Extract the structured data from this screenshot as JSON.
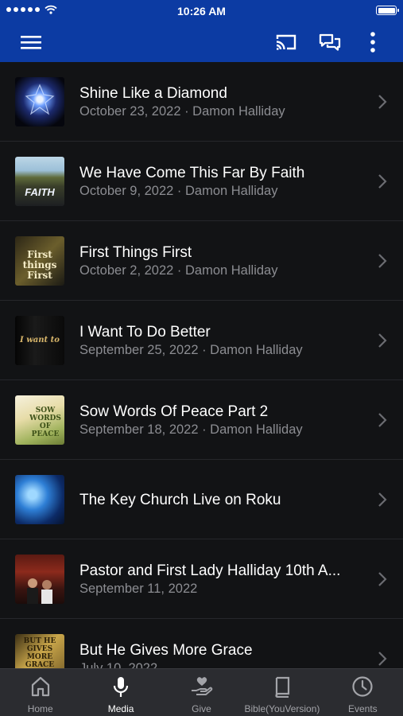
{
  "status_bar": {
    "time": "10:26 AM"
  },
  "app_bar": {
    "menu_icon": "hamburger-menu-icon",
    "cast_icon": "cast-icon",
    "chat_icon": "chat-bubbles-icon",
    "more_icon": "more-vertical-icon"
  },
  "media_items": [
    {
      "title": "Shine Like a Diamond",
      "subtitle": "October 23, 2022 · Damon Halliday"
    },
    {
      "title": "We Have Come This Far By Faith",
      "subtitle": "October 9, 2022 · Damon Halliday",
      "thumb_text": "FAITH"
    },
    {
      "title": "First Things First",
      "subtitle": "October 2, 2022 · Damon Halliday",
      "thumb_text": "First things First"
    },
    {
      "title": "I Want To Do Better",
      "subtitle": "September 25, 2022 · Damon Halliday",
      "thumb_text": "I want to"
    },
    {
      "title": "Sow Words Of Peace Part 2",
      "subtitle": "September 18, 2022 · Damon Halliday",
      "thumb_text": "SOW WORDS OF PEACE"
    },
    {
      "title": "The Key Church Live on Roku",
      "subtitle": ""
    },
    {
      "title": "Pastor and First Lady Halliday 10th A...",
      "subtitle": "September 11, 2022"
    },
    {
      "title": "But He Gives More Grace",
      "subtitle": "July 10, 2022",
      "thumb_text": "BUT HE GIVES MORE GRACE"
    }
  ],
  "tabs": [
    {
      "label": "Home",
      "icon": "home-icon",
      "active": false
    },
    {
      "label": "Media",
      "icon": "microphone-icon",
      "active": true
    },
    {
      "label": "Give",
      "icon": "give-hand-icon",
      "active": false
    },
    {
      "label": "Bible(YouVersion)",
      "icon": "bible-book-icon",
      "active": false
    },
    {
      "label": "Events",
      "icon": "clock-icon",
      "active": false
    }
  ],
  "colors": {
    "brand": "#0c3ba3",
    "background": "#121315",
    "tabbar": "#2b2c30"
  }
}
